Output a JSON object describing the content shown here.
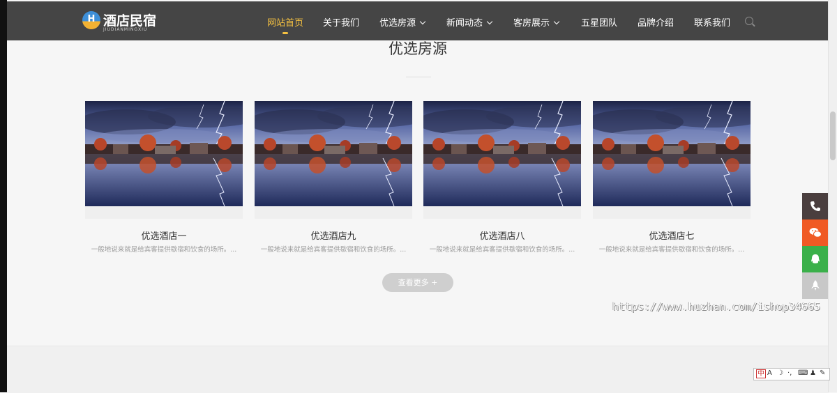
{
  "logo": {
    "badge": "H",
    "title": "酒店民宿",
    "subtitle": "JIUDIANMINGXIU"
  },
  "nav": {
    "items": [
      {
        "label": "网站首页",
        "active": true,
        "dropdown": false
      },
      {
        "label": "关于我们",
        "dropdown": false
      },
      {
        "label": "优选房源",
        "dropdown": true
      },
      {
        "label": "新闻动态",
        "dropdown": true
      },
      {
        "label": "客房展示",
        "dropdown": true
      },
      {
        "label": "五星团队",
        "dropdown": false
      },
      {
        "label": "品牌介绍",
        "dropdown": false
      },
      {
        "label": "联系我们",
        "dropdown": false
      }
    ],
    "search_icon": "search-icon"
  },
  "section": {
    "title": "优选房源"
  },
  "cards": [
    {
      "title": "优选酒店一",
      "desc": "一般地说来就是给宾客提供歇宿和饮食的场所。..."
    },
    {
      "title": "优选酒店九",
      "desc": "一般地说来就是给宾客提供歇宿和饮食的场所。..."
    },
    {
      "title": "优选酒店八",
      "desc": "一般地说来就是给宾客提供歇宿和饮食的场所。..."
    },
    {
      "title": "优选酒店七",
      "desc": "一般地说来就是给宾客提供歇宿和饮食的场所。..."
    }
  ],
  "more_button": "查看更多 +",
  "watermark": "https://www.huzhan.com/ishop34665",
  "float_buttons": [
    "phone-icon",
    "wechat-icon",
    "qq-icon",
    "rocket-icon"
  ],
  "colors": {
    "navbar": "#454545",
    "accent": "#f5c141",
    "phone": "#4a3e3e",
    "wechat": "#f05a24",
    "qq": "#3ab04a",
    "top": "#c8c8c8"
  }
}
